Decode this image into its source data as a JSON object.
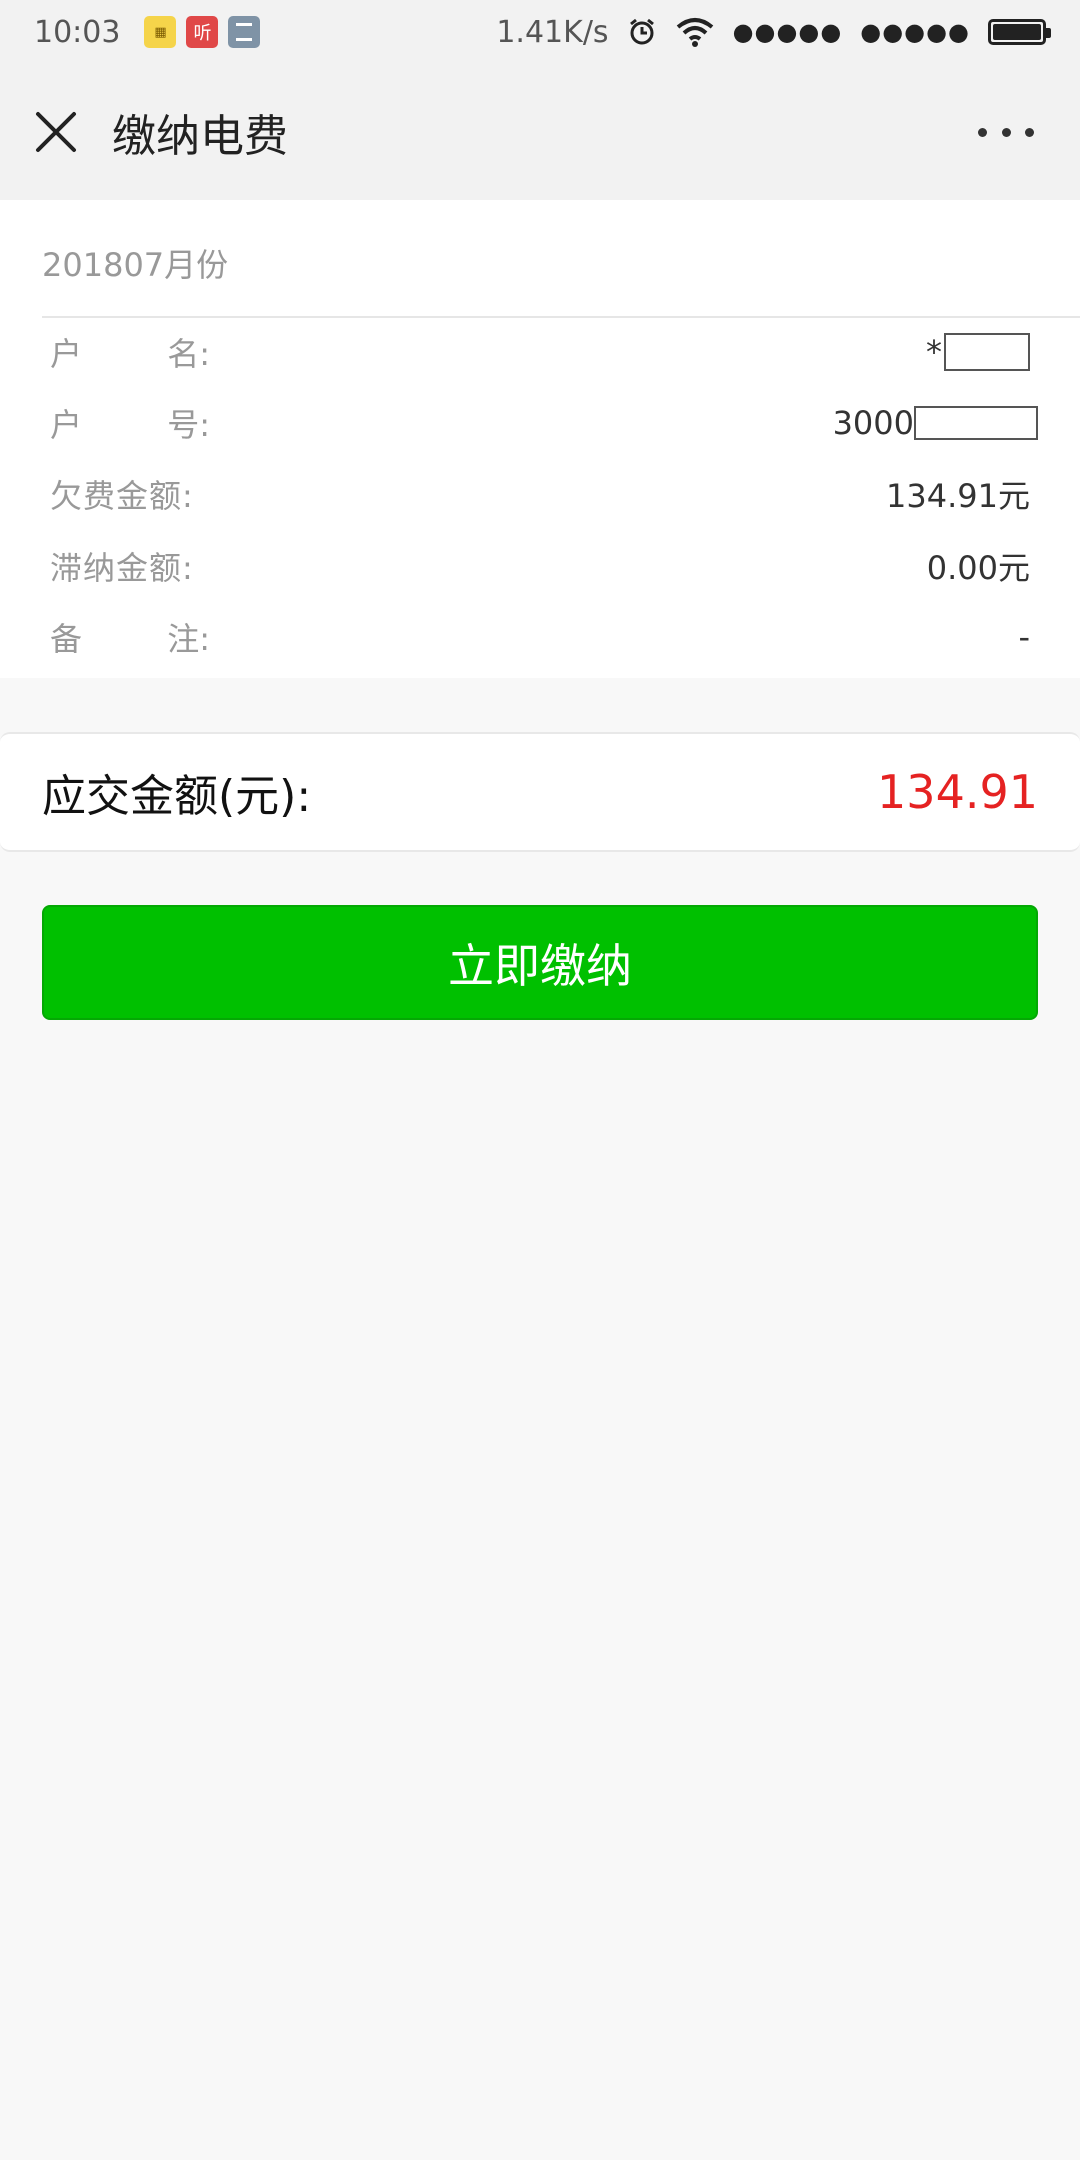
{
  "status_bar": {
    "time": "10:03",
    "notif_icons": [
      "app-icon",
      "listen-icon",
      "news-icon"
    ],
    "net_speed": "1.41K/s",
    "notif_b_text": "听",
    "notif_a_text": "🍩",
    "signal_1": "●●●●●",
    "signal_2": "●●●●●"
  },
  "header": {
    "title": "缴纳电费"
  },
  "bill": {
    "month": "201807月份",
    "rows": [
      {
        "label_a": "户",
        "label_b": "名:",
        "value": "*"
      },
      {
        "label_a": "户",
        "label_b": "号:",
        "value": "3000"
      },
      {
        "label": "欠费金额:",
        "value": "134.91元"
      },
      {
        "label": "滞纳金额:",
        "value": "0.00元"
      },
      {
        "label_a": "备",
        "label_b": "注:",
        "value": "-"
      }
    ]
  },
  "amount": {
    "label": "应交金额(元):",
    "value": "134.91"
  },
  "pay_button": {
    "label": "立即缴纳"
  },
  "colors": {
    "accent_green": "#00c000",
    "amount_red": "#e52222"
  }
}
